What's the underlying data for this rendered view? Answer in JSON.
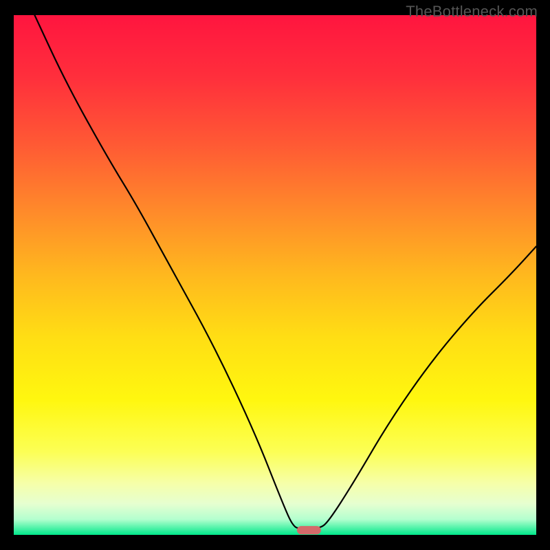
{
  "watermark": "TheBottleneck.com",
  "chart_data": {
    "type": "line",
    "title": "",
    "xlabel": "",
    "ylabel": "",
    "xlim": [
      0,
      100
    ],
    "ylim": [
      0,
      100
    ],
    "background_gradient": {
      "stops": [
        {
          "offset": 0.0,
          "color": "#ff153f"
        },
        {
          "offset": 0.12,
          "color": "#ff2f3c"
        },
        {
          "offset": 0.25,
          "color": "#ff5a34"
        },
        {
          "offset": 0.38,
          "color": "#ff8b2a"
        },
        {
          "offset": 0.5,
          "color": "#ffb81e"
        },
        {
          "offset": 0.62,
          "color": "#ffde14"
        },
        {
          "offset": 0.74,
          "color": "#fff70f"
        },
        {
          "offset": 0.84,
          "color": "#fcff55"
        },
        {
          "offset": 0.9,
          "color": "#f6ffa8"
        },
        {
          "offset": 0.94,
          "color": "#e6ffd0"
        },
        {
          "offset": 0.97,
          "color": "#b4ffcf"
        },
        {
          "offset": 1.0,
          "color": "#00e88a"
        }
      ]
    },
    "curve": {
      "description": "V-shaped bottleneck curve with minimum near x≈56",
      "points": [
        {
          "x": 4.0,
          "y": 100.0
        },
        {
          "x": 10.0,
          "y": 87.0
        },
        {
          "x": 18.0,
          "y": 72.5
        },
        {
          "x": 23.5,
          "y": 63.5
        },
        {
          "x": 30.0,
          "y": 51.5
        },
        {
          "x": 38.0,
          "y": 37.0
        },
        {
          "x": 46.0,
          "y": 20.0
        },
        {
          "x": 51.5,
          "y": 6.0
        },
        {
          "x": 53.5,
          "y": 1.5
        },
        {
          "x": 55.0,
          "y": 1.2
        },
        {
          "x": 58.5,
          "y": 1.2
        },
        {
          "x": 60.2,
          "y": 2.5
        },
        {
          "x": 65.0,
          "y": 10.0
        },
        {
          "x": 72.0,
          "y": 22.0
        },
        {
          "x": 80.0,
          "y": 33.5
        },
        {
          "x": 88.0,
          "y": 43.0
        },
        {
          "x": 95.0,
          "y": 50.0
        },
        {
          "x": 100.0,
          "y": 55.5
        }
      ]
    },
    "marker": {
      "shape": "rounded-pill",
      "cx": 56.5,
      "cy": 0.9,
      "width": 4.6,
      "height": 1.6,
      "color": "#d46a6a"
    }
  }
}
